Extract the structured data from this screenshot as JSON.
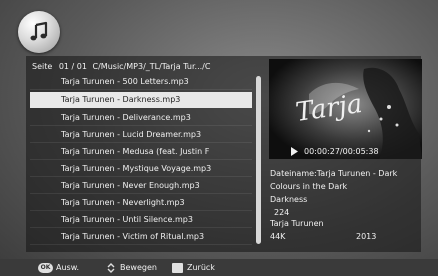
{
  "header": {
    "icon": "music-note-icon"
  },
  "path": {
    "label": "Seite",
    "page": "01 / 01",
    "text": "C/Music/MP3/_TL/Tarja Tur.../C"
  },
  "playlist": {
    "selected_index": 1,
    "items": [
      "Tarja Turunen - 500 Letters.mp3",
      "Tarja Turunen - Darkness.mp3",
      "Tarja Turunen - Deliverance.mp3",
      "Tarja Turunen - Lucid Dreamer.mp3",
      "Tarja Turunen - Medusa (feat. Justin F",
      "Tarja Turunen - Mystique Voyage.mp3",
      "Tarja Turunen - Never Enough.mp3",
      "Tarja Turunen - Neverlight.mp3",
      "Tarja Turunen - Until Silence.mp3",
      "Tarja Turunen - Victim of Ritual.mp3"
    ]
  },
  "player": {
    "time": "00:00:27/00:05:38",
    "cover_text": "Tarja"
  },
  "details": {
    "line1": "Dateiname:Tarja Turunen - Dark",
    "line2": "Colours in the Dark",
    "line3": "Darkness",
    "line4": "224",
    "line5": "Tarja Turunen",
    "bitrate": "44K",
    "year": "2013"
  },
  "footer": {
    "ok_icon_text": "OK",
    "ok_label": "Ausw.",
    "move_label": "Bewegen",
    "back_label": "Zurück"
  },
  "colors": {
    "highlight": "#e8e8e8",
    "panel": "#141414"
  }
}
